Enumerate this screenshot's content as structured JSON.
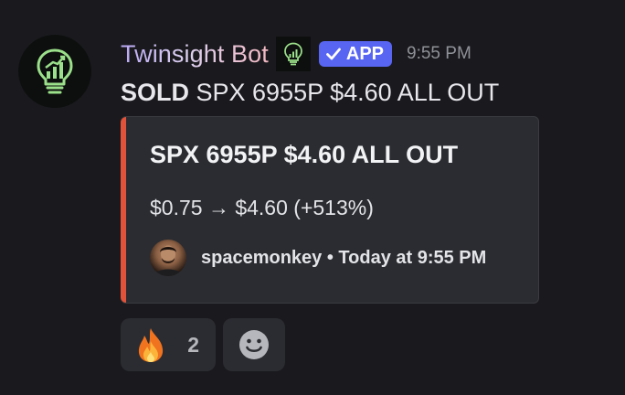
{
  "message": {
    "author": "Twinsight Bot",
    "badge": "APP",
    "timestamp": "9:55 PM",
    "content_bold": "SOLD",
    "content_rest": " SPX 6955P $4.60 ALL OUT",
    "avatar_icon": "lightbulb-chart-icon",
    "badge_color": "#5865f2"
  },
  "embed": {
    "accent_color": "#e0533a",
    "title": "SPX 6955P $4.60 ALL OUT",
    "description": "$0.75 → $4.60 (+513%)",
    "footer_text": "spacemonkey • Today at 9:55 PM"
  },
  "reactions": [
    {
      "emoji": "fire-emoji-icon",
      "count": "2"
    },
    {
      "emoji": "add-reaction-icon"
    }
  ]
}
